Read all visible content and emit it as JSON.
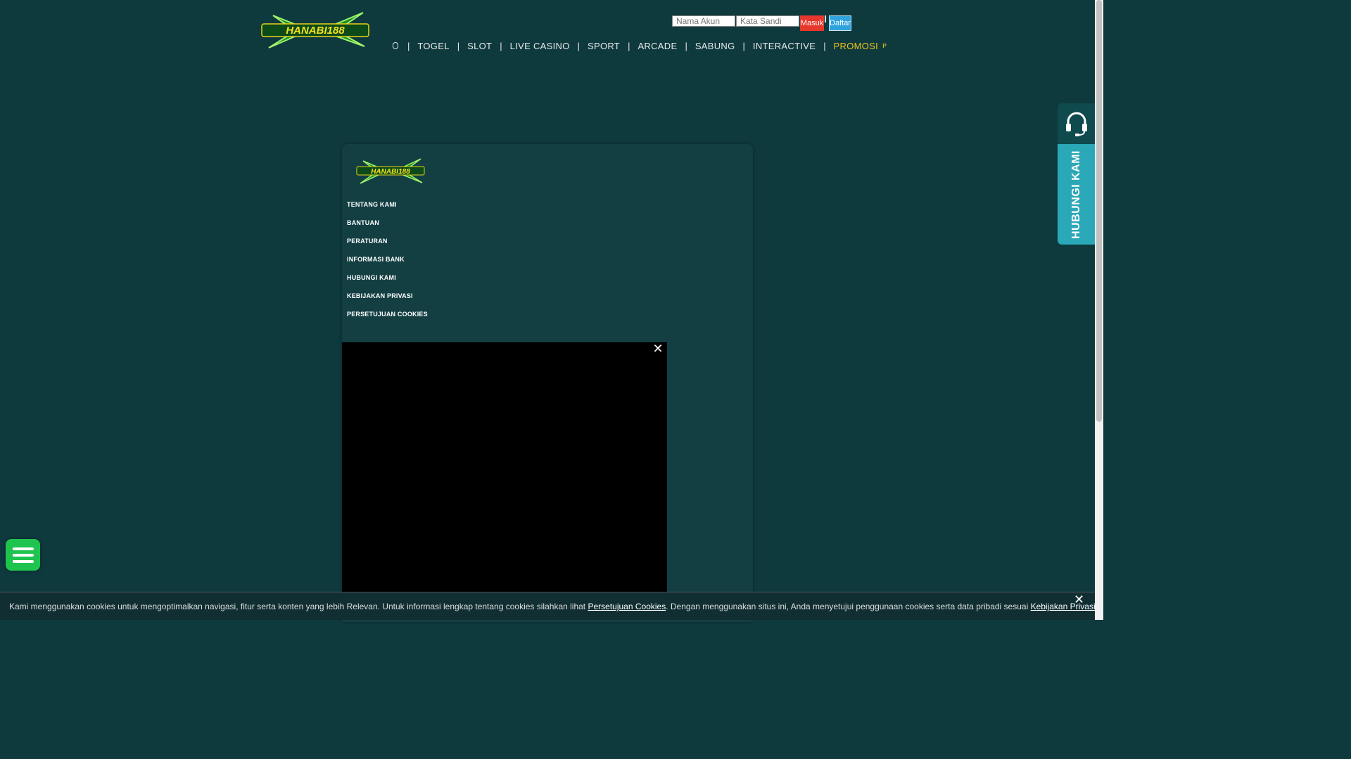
{
  "brand": {
    "logo_text": "HANABI188"
  },
  "login": {
    "username_placeholder": "Nama Akun",
    "password_placeholder": "Kata Sandi",
    "login_label": "Masuk",
    "register_label": "Daftar"
  },
  "nav": {
    "items": [
      "TOGEL",
      "SLOT",
      "LIVE CASINO",
      "SPORT",
      "ARCADE",
      "SABUNG",
      "INTERACTIVE"
    ],
    "promo_label": "PROMOSI"
  },
  "panel": {
    "links": [
      "TENTANG KAMI",
      "BANTUAN",
      "PERATURAN",
      "INFORMASI BANK",
      "HUBUNGI KAMI",
      "KEBIJAKAN PRIVASI",
      "PERSETUJUAN COOKIES"
    ]
  },
  "contact": {
    "label": "HUBUNGI KAMI"
  },
  "cookie": {
    "text_before": "Kami menggunakan cookies untuk mengoptimalkan navigasi, fitur serta konten yang lebih Relevan. Untuk informasi lengkap tentang cookies silahkan lihat ",
    "link1": "Persetujuan Cookies",
    "text_middle": ". Dengan menggunakan situs ini, Anda menyetujui penggunaan cookies serta data pribadi sesuai ",
    "link2": "Kebijakan Privasi",
    "text_after": "."
  },
  "colors": {
    "background": "#0e3a3e",
    "accent_green": "#1ec44e",
    "promo": "#f0c419",
    "login_red": "#e8372c",
    "register_blue": "#2fa3de",
    "contact_tab": "#2aa8b8"
  }
}
